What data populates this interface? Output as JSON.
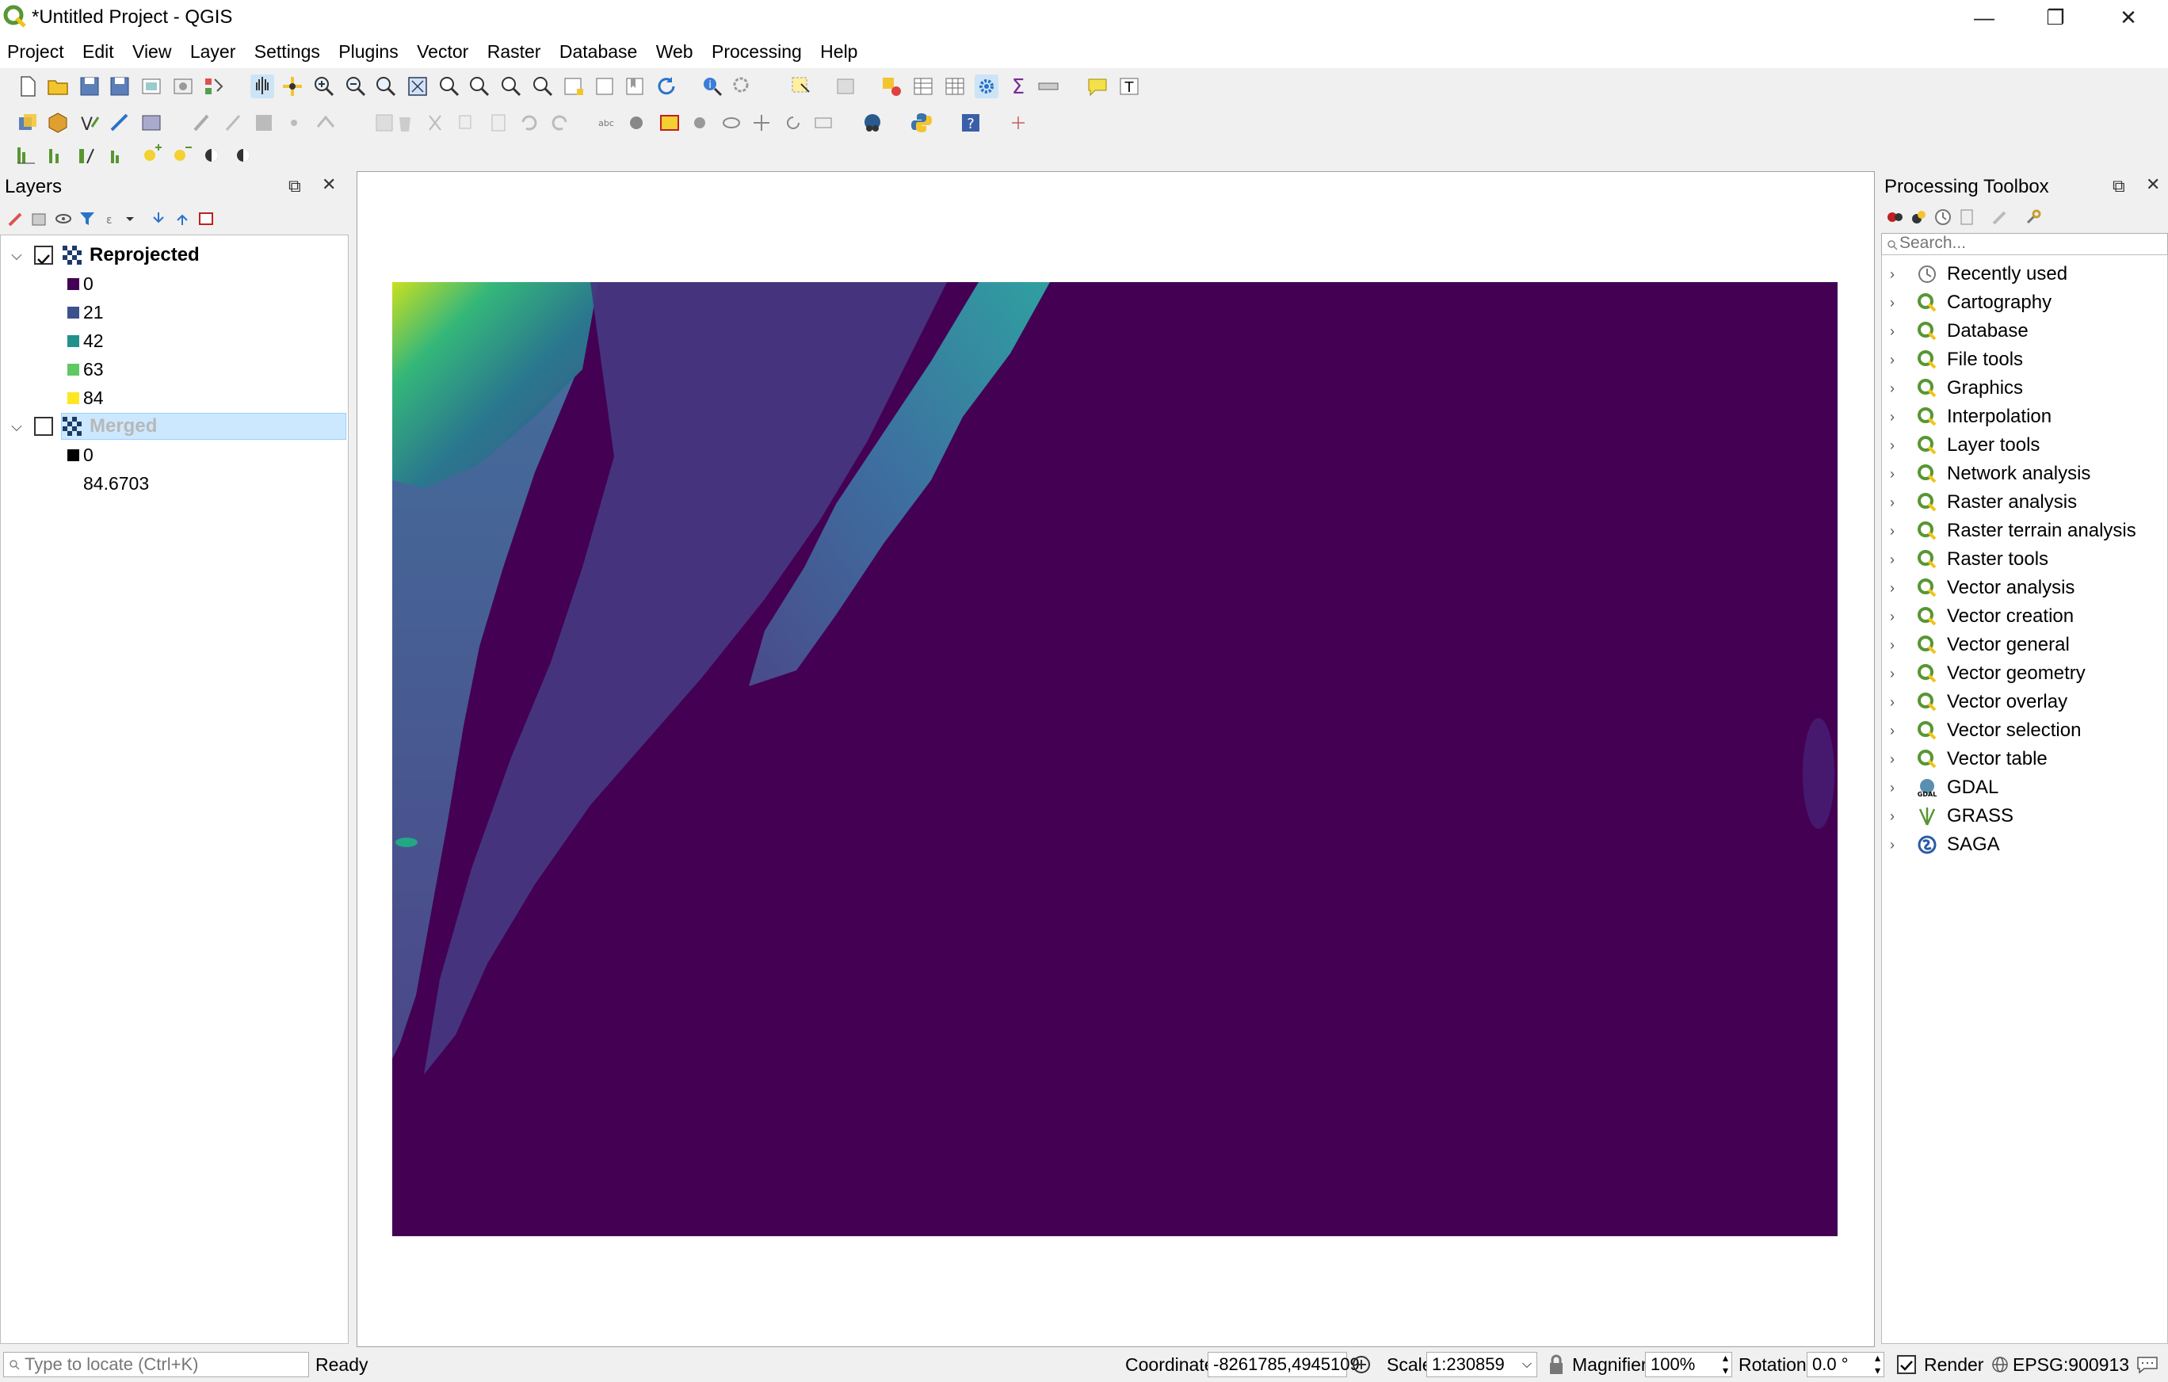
{
  "window": {
    "title": "*Untitled Project - QGIS",
    "minimize": "—",
    "restore": "❐",
    "close": "✕"
  },
  "menu": [
    "Project",
    "Edit",
    "View",
    "Layer",
    "Settings",
    "Plugins",
    "Vector",
    "Raster",
    "Database",
    "Web",
    "Processing",
    "Help"
  ],
  "layers_panel": {
    "title": "Layers",
    "layers": [
      {
        "name": "Reprojected",
        "checked": true,
        "legend": [
          {
            "label": "0",
            "color": "#440154"
          },
          {
            "label": "21",
            "color": "#3b528b"
          },
          {
            "label": "42",
            "color": "#21918c"
          },
          {
            "label": "63",
            "color": "#5ec962"
          },
          {
            "label": "84",
            "color": "#fde725"
          }
        ]
      },
      {
        "name": "Merged",
        "checked": false,
        "legend_min": "0",
        "legend_max": "84.6703"
      }
    ]
  },
  "toolbox": {
    "title": "Processing Toolbox",
    "search_placeholder": "Search...",
    "items": [
      {
        "label": "Recently used",
        "icon": "clock-icon"
      },
      {
        "label": "Cartography",
        "icon": "qgis-icon"
      },
      {
        "label": "Database",
        "icon": "qgis-icon"
      },
      {
        "label": "File tools",
        "icon": "qgis-icon"
      },
      {
        "label": "Graphics",
        "icon": "qgis-icon"
      },
      {
        "label": "Interpolation",
        "icon": "qgis-icon"
      },
      {
        "label": "Layer tools",
        "icon": "qgis-icon"
      },
      {
        "label": "Network analysis",
        "icon": "qgis-icon"
      },
      {
        "label": "Raster analysis",
        "icon": "qgis-icon"
      },
      {
        "label": "Raster terrain analysis",
        "icon": "qgis-icon"
      },
      {
        "label": "Raster tools",
        "icon": "qgis-icon"
      },
      {
        "label": "Vector analysis",
        "icon": "qgis-icon"
      },
      {
        "label": "Vector creation",
        "icon": "qgis-icon"
      },
      {
        "label": "Vector general",
        "icon": "qgis-icon"
      },
      {
        "label": "Vector geometry",
        "icon": "qgis-icon"
      },
      {
        "label": "Vector overlay",
        "icon": "qgis-icon"
      },
      {
        "label": "Vector selection",
        "icon": "qgis-icon"
      },
      {
        "label": "Vector table",
        "icon": "qgis-icon"
      },
      {
        "label": "GDAL",
        "icon": "gdal-icon"
      },
      {
        "label": "GRASS",
        "icon": "grass-icon"
      },
      {
        "label": "SAGA",
        "icon": "saga-icon"
      }
    ]
  },
  "statusbar": {
    "locate_placeholder": "Type to locate (Ctrl+K)",
    "status": "Ready",
    "coordinate_label": "Coordinate",
    "coordinate_value": "-8261785,4945109",
    "scale_label": "Scale",
    "scale_value": "1:230859",
    "magnifier_label": "Magnifier",
    "magnifier_value": "100%",
    "rotation_label": "Rotation",
    "rotation_value": "0.0 °",
    "render_label": "Render",
    "crs": "EPSG:900913"
  },
  "colors": {
    "viridis_dark": "#440154",
    "selection": "#cce8ff",
    "qgis_green": "#589632"
  }
}
